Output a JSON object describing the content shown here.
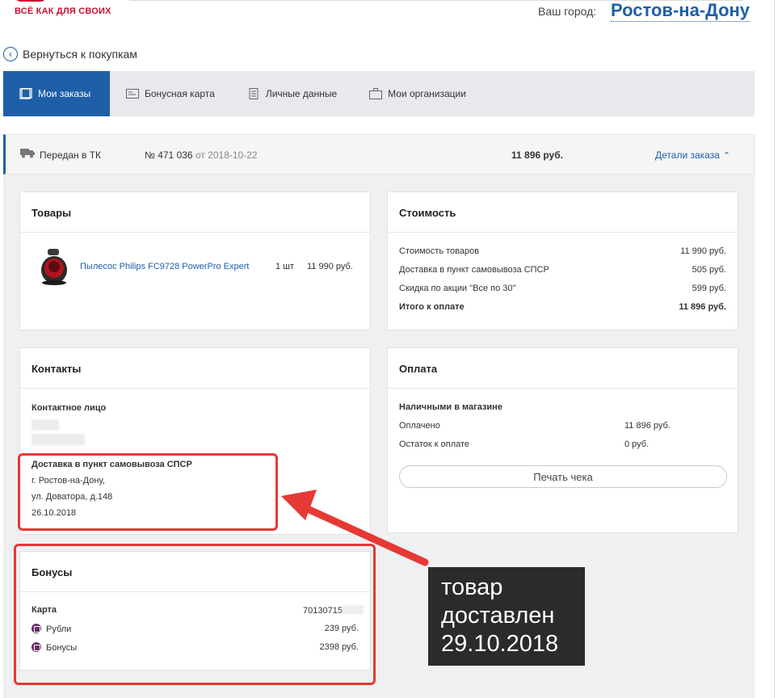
{
  "header": {
    "logo_text": "ВСЁ КАК ДЛЯ СВОИХ",
    "city_label": "Ваш город:",
    "city_value": "Ростов-на-Дону",
    "back_label": "Вернуться к покупкам"
  },
  "tabs": [
    {
      "label": "Мои заказы",
      "active": true
    },
    {
      "label": "Бонусная карта"
    },
    {
      "label": "Личные данные"
    },
    {
      "label": "Мои организации"
    }
  ],
  "order": {
    "status": "Передан в ТК",
    "number": "№ 471 036",
    "date": "от 2018-10-22",
    "sum": "11 896 руб.",
    "details_label": "Детали заказа"
  },
  "goods": {
    "title": "Товары",
    "product_name": "Пылесос Philips FC9728 PowerPro Expert",
    "qty": "1 шт",
    "price": "11 990 руб."
  },
  "cost": {
    "title": "Стоимость",
    "rows": [
      {
        "label": "Стоимость товаров",
        "value": "11 990 руб."
      },
      {
        "label": "Доставка в пункт самовывоза СПСР",
        "value": "505 руб."
      },
      {
        "label": "Скидка по акции \"Все по 30\"",
        "value": "599 руб."
      },
      {
        "label": "Итого к оплате",
        "value": "11 896 руб."
      }
    ]
  },
  "contacts": {
    "title": "Контакты",
    "person_label": "Контактное лицо",
    "delivery_title": "Доставка в пункт самовывоза СПСР",
    "city": "г. Ростов-на-Дону,",
    "street": "ул. Доватора, д.148",
    "date": "26.10.2018"
  },
  "payment": {
    "title": "Оплата",
    "method": "Наличными в магазине",
    "paid_label": "Оплачено",
    "paid_value": "11 896 руб.",
    "remain_label": "Остаток к оплате",
    "remain_value": "0 руб.",
    "print_label": "Печать чека"
  },
  "bonuses": {
    "title": "Бонусы",
    "card_label": "Карта",
    "card_value": "70130715",
    "rub_label": "Рубли",
    "rub_value": "239 руб.",
    "bonus_label": "Бонусы",
    "bonus_value": "2398 руб."
  },
  "note": {
    "line1": "товар",
    "line2": "доставлен",
    "line3": "29.10.2018"
  },
  "colors": {
    "accent": "#1f5fa8",
    "brand": "#c8102e",
    "annotation": "#e53935"
  }
}
